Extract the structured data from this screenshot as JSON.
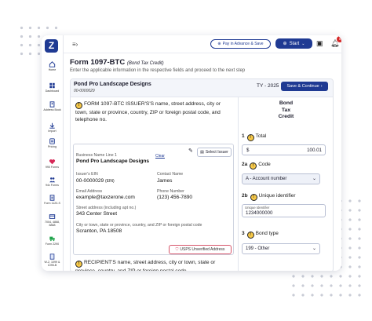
{
  "sidebar": {
    "items": [
      {
        "label": "Home",
        "icon": "home-icon"
      },
      {
        "label": "Dashboard",
        "icon": "dashboard-icon"
      },
      {
        "label": "Address Book",
        "icon": "address-book-icon"
      },
      {
        "label": "Import",
        "icon": "import-icon"
      },
      {
        "label": "Pricing",
        "icon": "pricing-icon"
      },
      {
        "label": "990 Forms",
        "icon": "forms-icon"
      },
      {
        "label": "94x Forms",
        "icon": "people-icon"
      },
      {
        "label": "Form 1120-S",
        "icon": "form-icon"
      },
      {
        "label": "7004, 4868, 8868",
        "icon": "extension-icon"
      },
      {
        "label": "Form 2290",
        "icon": "truck-icon"
      },
      {
        "label": "W-2, 1099 & 1095-B",
        "icon": "tax-forms-icon"
      }
    ]
  },
  "topbar": {
    "pay_label": "Pay in Advance & Save",
    "start_label": "Start",
    "notification_count": "6"
  },
  "page": {
    "title": "Form 1097-BTC",
    "subtitle": "(Bond Tax Credit)",
    "description": "Enter the applicable information in the respective fields and proceed to the next step"
  },
  "header": {
    "company": "Pond Pro Landscape Designs",
    "tin": "00-0000029",
    "year": "TY - 2025",
    "save_label": "Save & Continue"
  },
  "issuer": {
    "section_text": "FORM 1097-BTC ISSUER'S'S name, street address, city or town, state or province, country, ZIP or foreign postal code, and telephone no.",
    "select_label": "Select Issuer",
    "business_name_label": "Business Name Line 1",
    "clear_label": "Clear",
    "business_name": "Pond Pro Landscape Designs",
    "ein_label": "Issuer's EIN",
    "ein": "00-0000029",
    "ein_type": "(EIN)",
    "contact_label": "Contact Name",
    "contact": "James",
    "email_label": "Email Address",
    "email": "example@taxzerone.com",
    "phone_label": "Phone Number",
    "phone": "(123) 456-7890",
    "street_label": "Street address (including apt no.)",
    "street": "343 Center Street",
    "city_label": "City or town, state or province, country, and ZIP or foreign postal code",
    "city": "Scranton, PA 18508",
    "usps_label": "USPS Unverified Address"
  },
  "recipient": {
    "section_text": "RECIPIENT'S name, street address, city or town, state or province, country, and ZIP or foreign postal code"
  },
  "bond_panel": {
    "title_line1": "Bond",
    "title_line2": "Tax",
    "title_line3": "Credit",
    "box1_no": "1",
    "box1_label": "Total",
    "box1_currency": "$",
    "box1_value": "100.01",
    "box2a_no": "2a",
    "box2a_label": "Code",
    "box2a_value": "A - Account number",
    "box2b_no": "2b",
    "box2b_label": "Unique identifier",
    "box2b_float": "Unique Identifier",
    "box2b_value": "1234000000",
    "box3_no": "3",
    "box3_label": "Bond type",
    "box3_value": "199 - Other"
  },
  "colors": {
    "primary": "#1f3a93",
    "warning": "#f7c948",
    "danger": "#d62828"
  }
}
